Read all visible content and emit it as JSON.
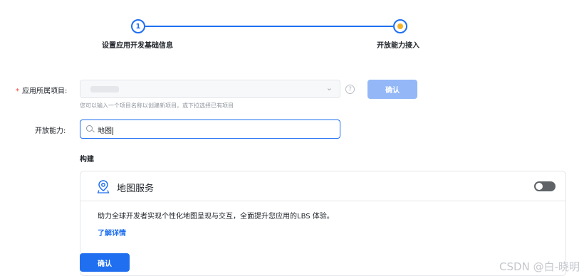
{
  "stepper": {
    "step1_number": "1",
    "step1_label": "设置应用开发基础信息",
    "step2_label": "开放能力接入",
    "active_color": "#1f6ff0",
    "current_dot_color": "#f5b326"
  },
  "form": {
    "project_label": "应用所属项目:",
    "project_required_mark": "*",
    "project_hint": "您可以输入一个项目名称以创建新项目，或下拉选择已有项目",
    "confirm_top_label": "确认",
    "ability_label": "开放能力:",
    "search_value": "地图",
    "section_title": "构建"
  },
  "card": {
    "title": "地图服务",
    "description": "助力全球开发者实现个性化地图呈现与交互，全面提升您应用的LBS 体验。",
    "link_label": "了解详情",
    "toggle_on": false,
    "icon": "map-location-icon"
  },
  "footer": {
    "confirm_label": "确认",
    "watermark": "CSDN @白-晓明"
  },
  "icons": {
    "chevron": "chevron-down-icon",
    "help": "help-icon",
    "search": "search-icon"
  }
}
